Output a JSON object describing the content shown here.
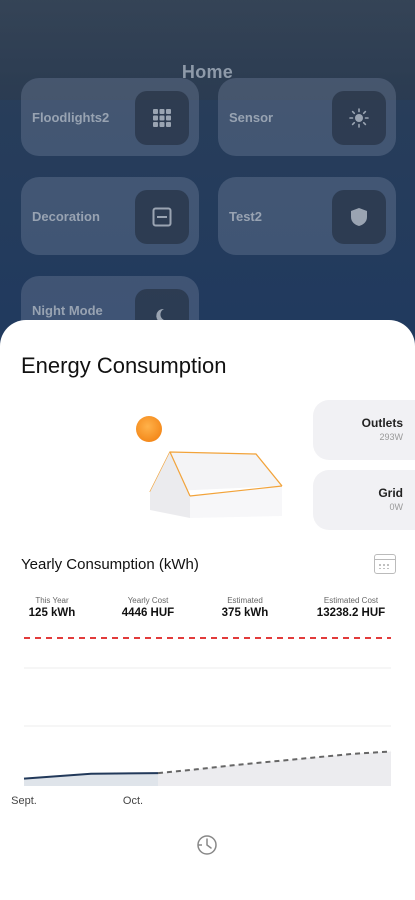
{
  "header": {
    "title": "Home"
  },
  "tiles": [
    {
      "label": "Floodlights2",
      "icon": "grid-icon"
    },
    {
      "label": "Sensor",
      "icon": "sun-icon"
    },
    {
      "label": "Decoration",
      "icon": "panel-icon"
    },
    {
      "label": "Test2",
      "icon": "shield-icon"
    },
    {
      "label": "Night Mode",
      "icon": "moon-icon"
    }
  ],
  "sheet": {
    "title": "Energy Consumption",
    "cards": [
      {
        "label": "Outlets",
        "value": "293W"
      },
      {
        "label": "Grid",
        "value": "0W"
      }
    ],
    "yearly": {
      "title": "Yearly Consumption (kWh)",
      "stats": [
        {
          "label": "This Year",
          "value": "125 kWh"
        },
        {
          "label": "Yearly Cost",
          "value": "4446 HUF"
        },
        {
          "label": "Estimated",
          "value": "375 kWh"
        },
        {
          "label": "Estimated Cost",
          "value": "13238.2 HUF"
        }
      ]
    }
  },
  "colors": {
    "accent_line": "#e23b3b",
    "actual_series": "#22395a",
    "sun": "#f07a0a",
    "roof_outline": "#f2a33a"
  },
  "chart_data": {
    "type": "area",
    "categories": [
      "Sept.",
      "Oct."
    ],
    "series": [
      {
        "values": [
          0.6,
          1.0,
          1.05
        ]
      },
      {
        "values": [
          1.05,
          1.35,
          1.7,
          2.0,
          2.3,
          2.6,
          2.8
        ]
      }
    ],
    "xlabel": "",
    "ylabel": ""
  }
}
